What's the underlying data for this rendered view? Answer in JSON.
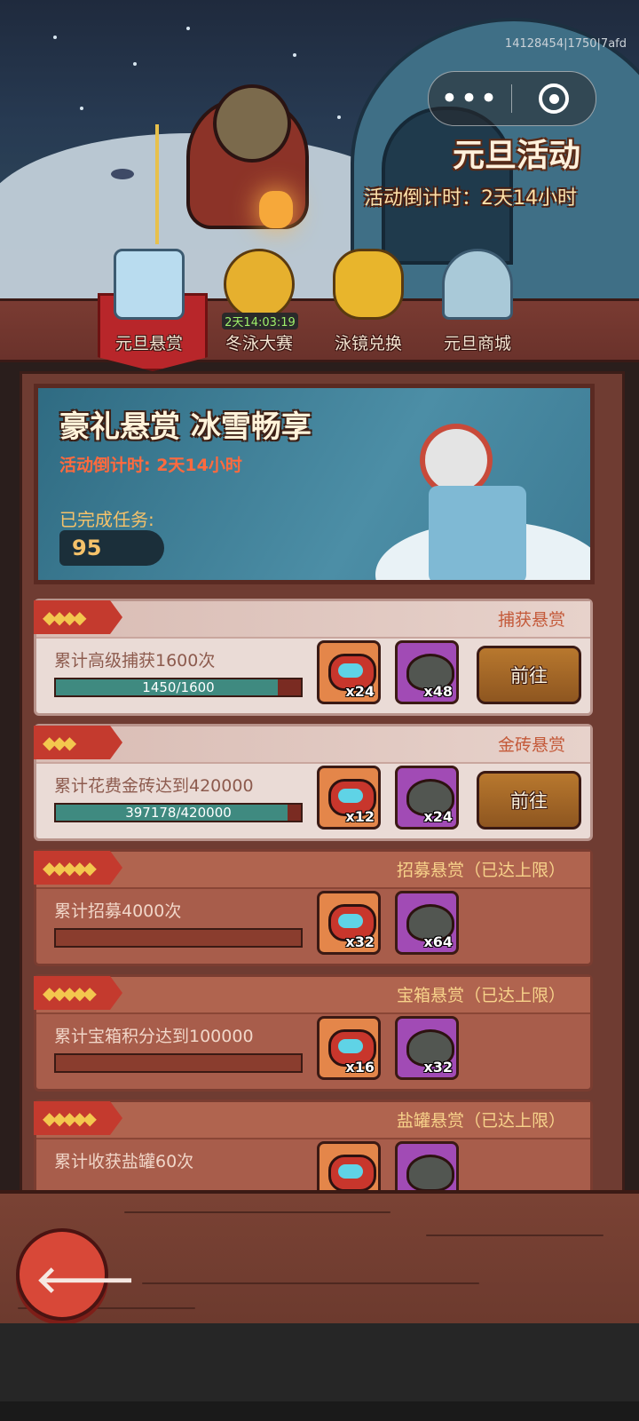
{
  "header": {
    "debug_id": "14128454|1750|7afd",
    "event_title": "元旦活动",
    "event_countdown": "活动倒计时：2天14小时",
    "menu_label": "•••"
  },
  "tabs": [
    {
      "label": "元旦悬赏",
      "active": true
    },
    {
      "label": "冬泳大赛",
      "timer": "2天14:03:19"
    },
    {
      "label": "泳镜兑换"
    },
    {
      "label": "元旦商城"
    }
  ],
  "banner": {
    "title": "豪礼悬赏 冰雪畅享",
    "countdown": "活动倒计时: 2天14小时",
    "done_label": "已完成任务:",
    "done_count": "95"
  },
  "tasks": [
    {
      "stars": "◆◆◆◆",
      "star_count": 4,
      "category": "捕获悬赏",
      "desc": "累计高级捕获1600次",
      "progress_text": "1450/1600",
      "progress": 0.906,
      "reward1": "x24",
      "reward2": "x48",
      "button": "前往"
    },
    {
      "stars": "◆◆◆",
      "star_count": 3,
      "category": "金砖悬赏",
      "desc": "累计花费金砖达到420000",
      "progress_text": "397178/420000",
      "progress": 0.946,
      "reward1": "x12",
      "reward2": "x24",
      "button": "前往"
    },
    {
      "stars": "◆◆◆◆◆",
      "star_count": 5,
      "category": "招募悬赏（已达上限）",
      "desc": "累计招募4000次",
      "progress": 0,
      "reward1": "x32",
      "reward2": "x64"
    },
    {
      "stars": "◆◆◆◆◆",
      "star_count": 5,
      "category": "宝箱悬赏（已达上限）",
      "desc": "累计宝箱积分达到100000",
      "progress": 0,
      "reward1": "x16",
      "reward2": "x32"
    },
    {
      "stars": "◆◆◆◆◆",
      "star_count": 5,
      "category": "盐罐悬赏（已达上限）",
      "desc": "累计收获盐罐60次"
    }
  ],
  "back_label": "🡐"
}
